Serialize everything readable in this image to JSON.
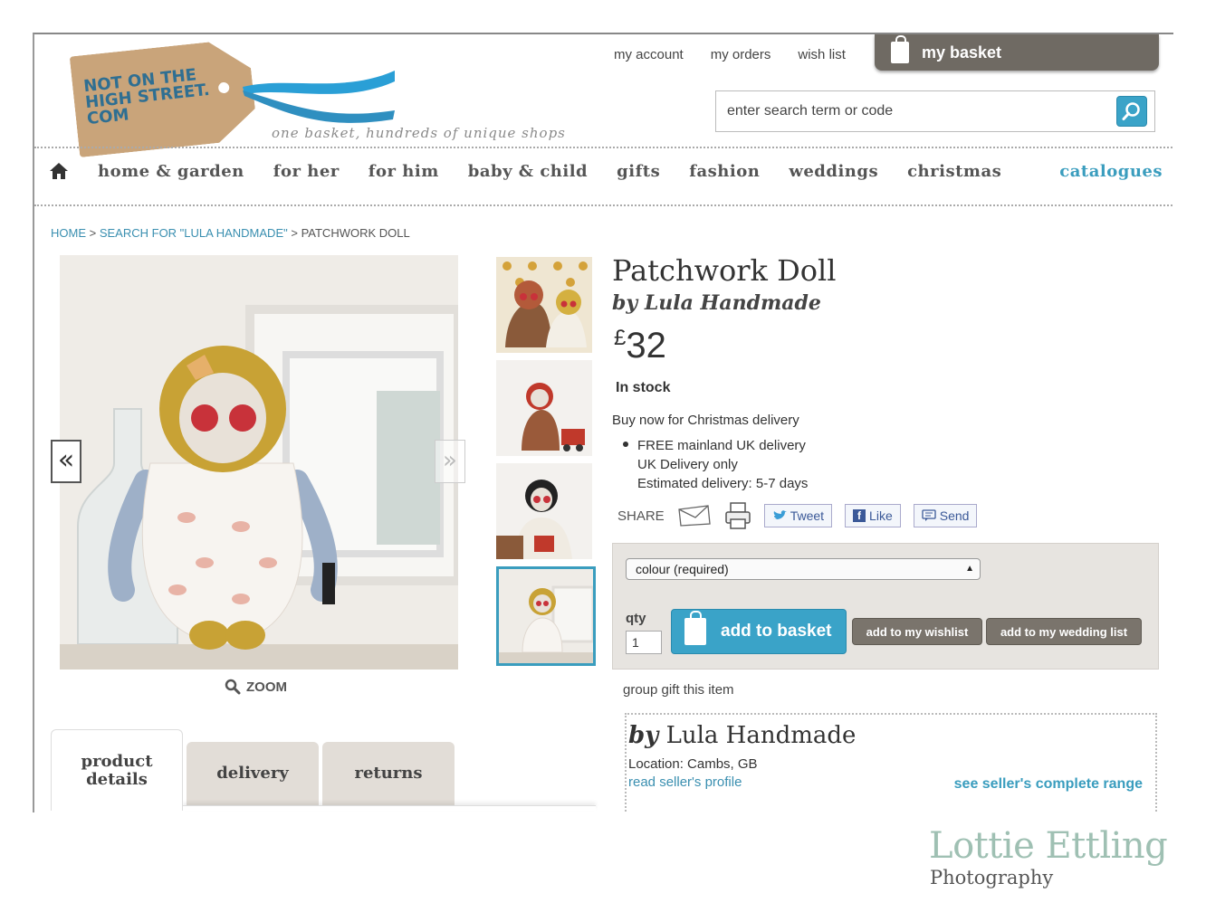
{
  "header": {
    "logo_text": "NOT ON THE\nHIGH STREET.\nCOM",
    "tagline": "one basket, hundreds of unique shops",
    "top_links": [
      "my account",
      "my orders",
      "wish list"
    ],
    "basket_label": "my basket",
    "search_placeholder": "enter search term or code"
  },
  "nav": {
    "items": [
      "home & garden",
      "for her",
      "for him",
      "baby & child",
      "gifts",
      "fashion",
      "weddings",
      "christmas"
    ],
    "catalogues": "catalogues"
  },
  "breadcrumb": {
    "home": "HOME",
    "sep": ">",
    "search": "SEARCH FOR \"LULA HANDMADE\"",
    "current": "PATCHWORK DOLL"
  },
  "gallery": {
    "prev": "«",
    "next": "»",
    "zoom_label": "ZOOM"
  },
  "product": {
    "title": "Patchwork Doll",
    "by": "by Lula Handmade",
    "currency": "£",
    "price": "32",
    "stock": "In stock",
    "buy_now": "Buy now for Christmas delivery",
    "delivery": [
      "FREE mainland UK delivery",
      "UK Delivery only",
      "Estimated delivery: 5-7 days"
    ]
  },
  "share": {
    "label": "SHARE",
    "tweet": "Tweet",
    "like": "Like",
    "send": "Send"
  },
  "buybox": {
    "select_value": "colour (required)",
    "qty_label": "qty",
    "qty_value": "1",
    "add_basket": "add to basket",
    "wishlist": "add to my wishlist",
    "wedding": "add to my wedding list"
  },
  "group_gift": "group gift this item",
  "seller": {
    "by": "by",
    "name": "Lula Handmade",
    "location": "Location: Cambs, GB",
    "profile_link": "read seller's profile",
    "range_link": "see seller's complete range"
  },
  "tabs": [
    "product details",
    "delivery",
    "returns"
  ],
  "watermark": {
    "name": "Lottie Ettling",
    "sub": "Photography"
  },
  "colors": {
    "accent": "#3aa3c8",
    "basket_tab": "#6f6a63",
    "buybox_bg": "#e7e4e0"
  }
}
